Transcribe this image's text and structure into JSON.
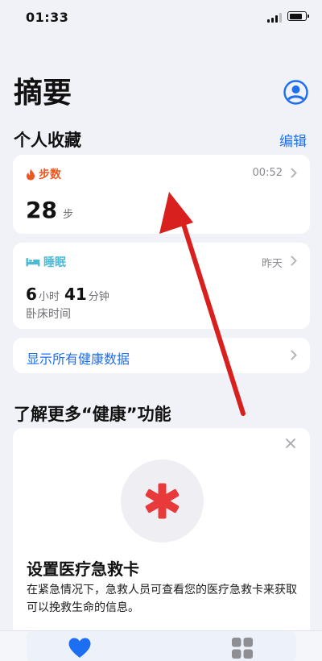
{
  "status_bar": {
    "time": "01:33"
  },
  "header": {
    "title": "摘要",
    "profile_icon": "person-circle-icon"
  },
  "favorites": {
    "heading": "个人收藏",
    "edit_label": "编辑",
    "steps": {
      "label": "步数",
      "icon": "flame-icon",
      "time": "00:52",
      "value": "28",
      "unit": "步"
    },
    "sleep": {
      "label": "睡眠",
      "icon": "bed-icon",
      "time": "昨天",
      "hours": "6",
      "hours_unit": "小时",
      "minutes": "41",
      "minutes_unit": "分钟",
      "caption": "卧床时间"
    },
    "show_all_label": "显示所有健康数据"
  },
  "learn_more": {
    "heading": "了解更多“健康”功能",
    "card_title": "设置医疗急救卡",
    "card_description": "在紧急情况下，急救人员可查看您的医疗急救卡来获取可以挽救生命的信息。",
    "icon": "medical-asterisk-icon"
  },
  "tab_bar": {
    "items": [
      {
        "icon": "heart-icon",
        "active": true
      },
      {
        "icon": "grid-icon",
        "active": false
      }
    ]
  },
  "colors": {
    "accent": "#1d6ff2",
    "steps": "#f0561f",
    "sleep": "#4fb8d4",
    "medical": "#e8393b",
    "annotation_arrow": "#d8201e"
  }
}
